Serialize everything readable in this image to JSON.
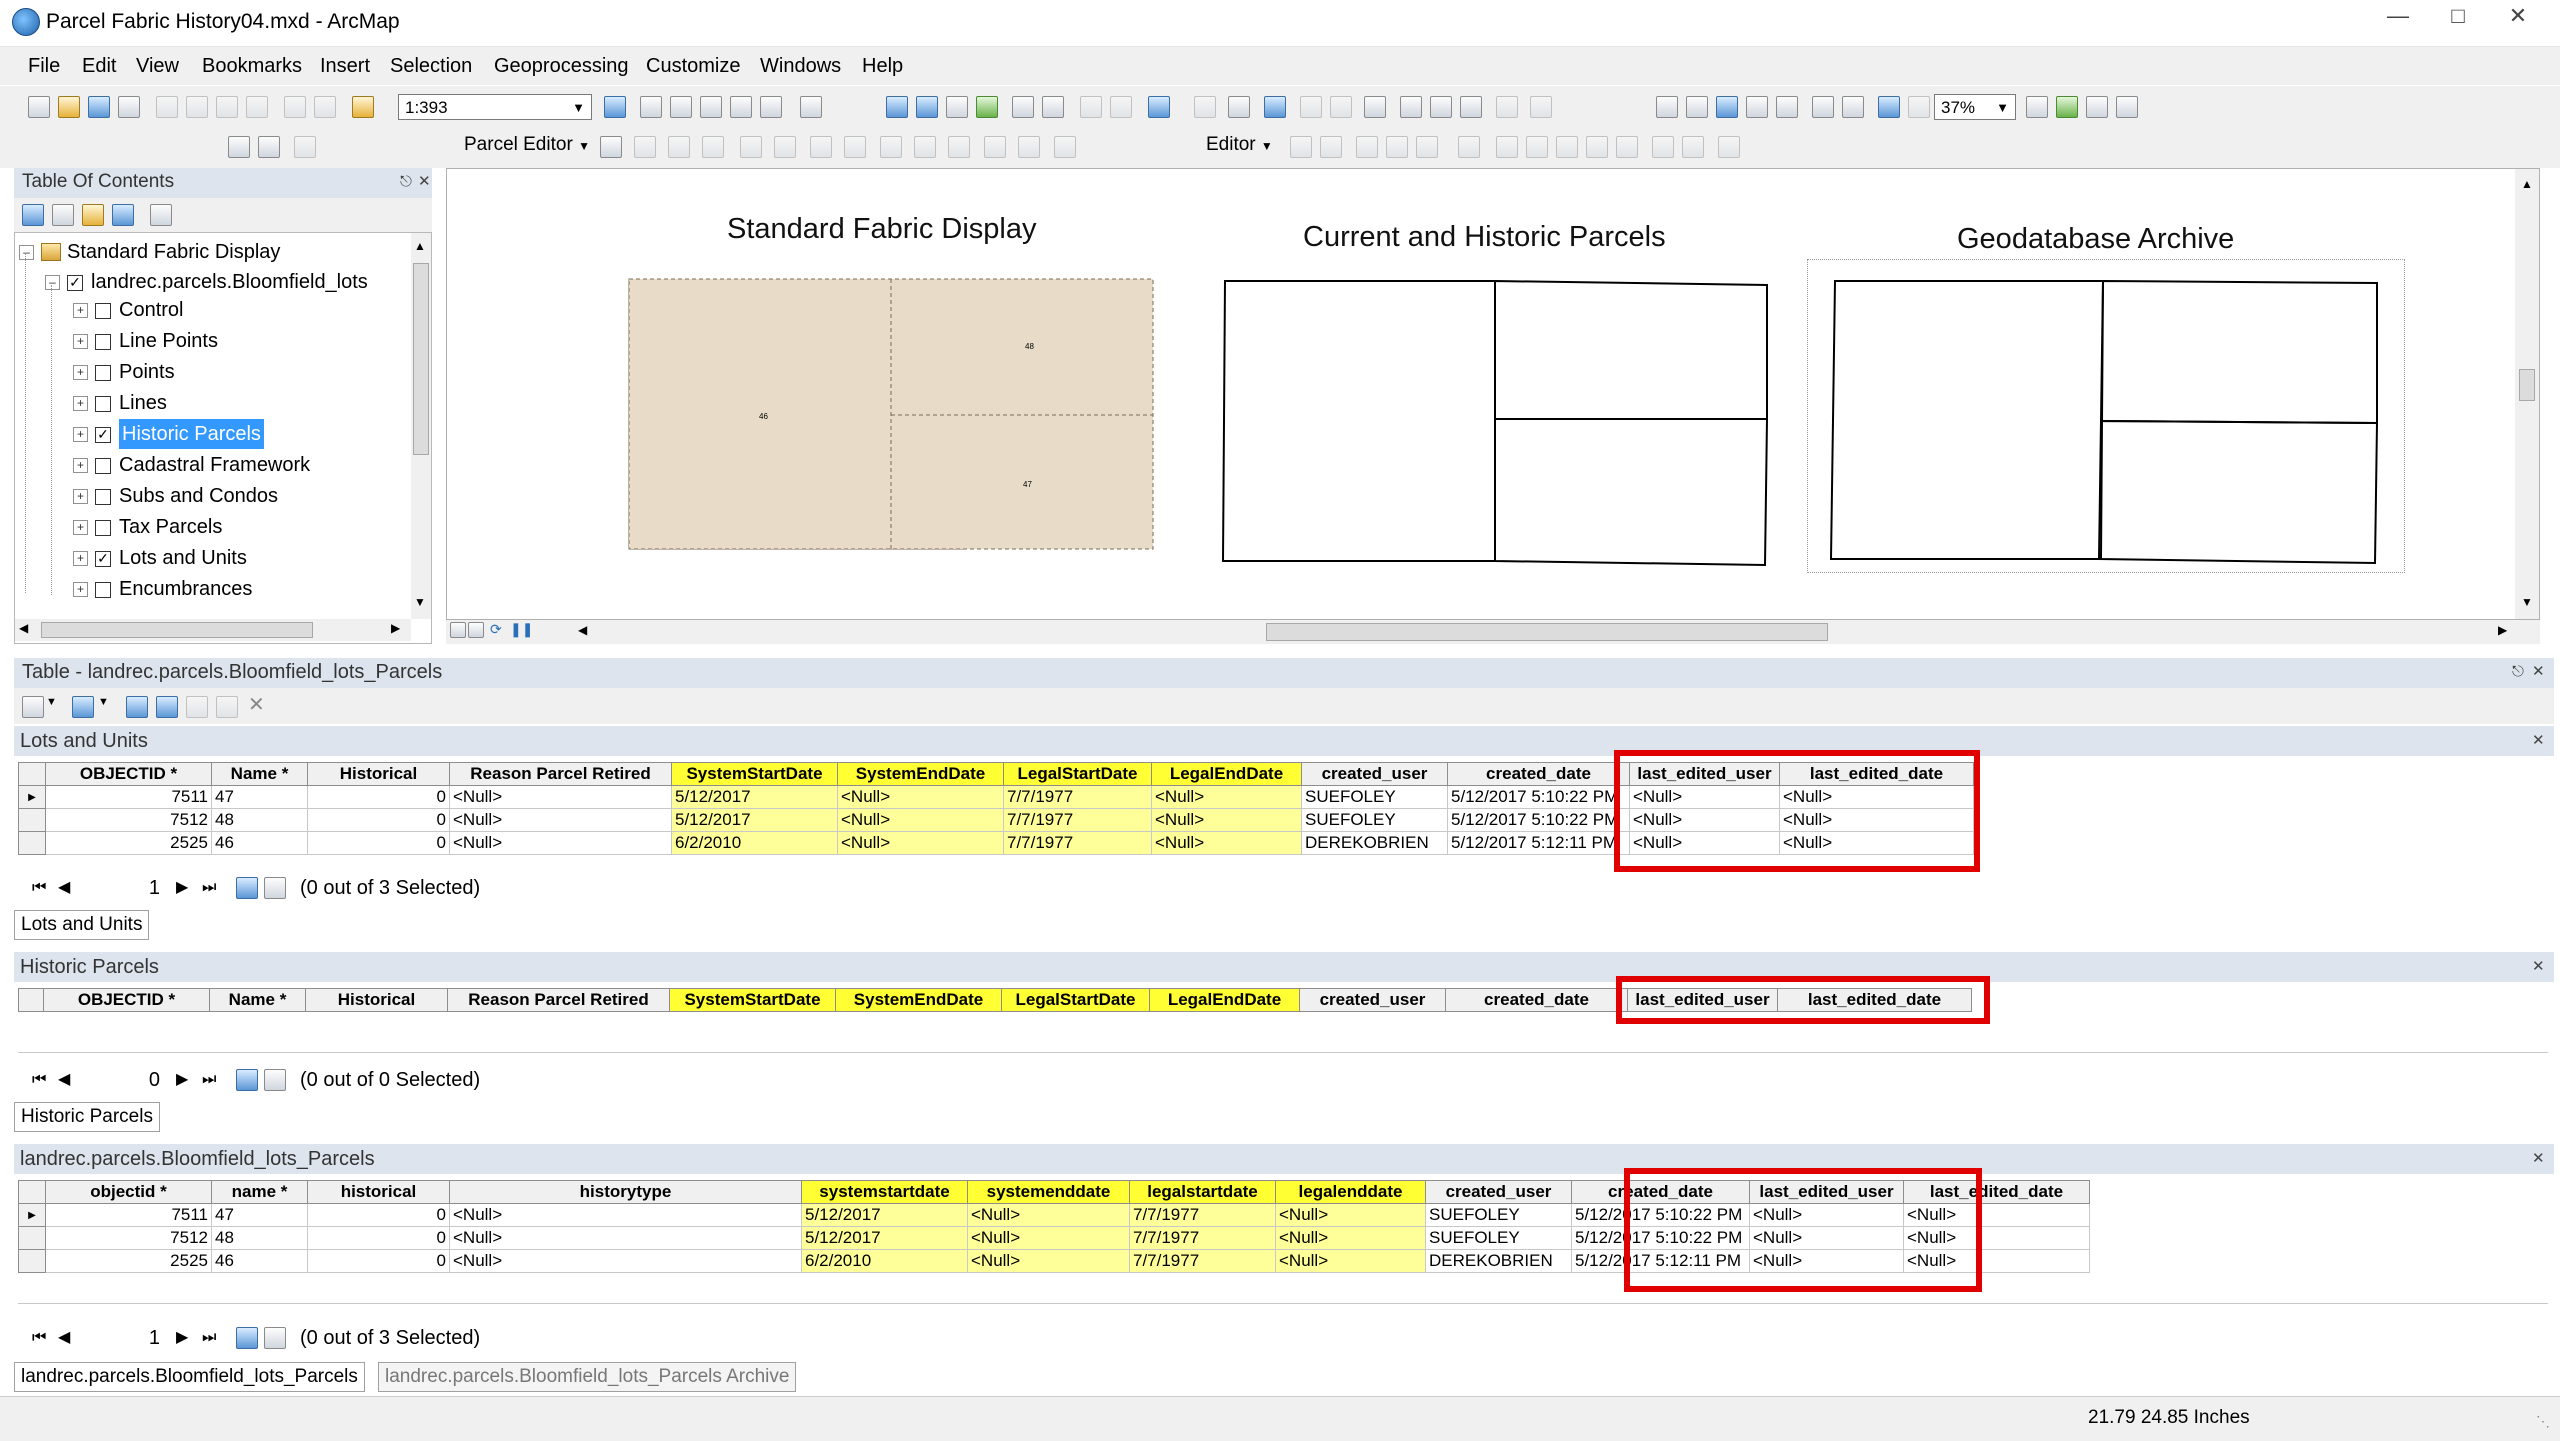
{
  "window": {
    "title": "Parcel Fabric History04.mxd - ArcMap"
  },
  "menu": [
    "File",
    "Edit",
    "View",
    "Bookmarks",
    "Insert",
    "Selection",
    "Geoprocessing",
    "Customize",
    "Windows",
    "Help"
  ],
  "toolbar": {
    "scale": "1:393",
    "zoom": "37%",
    "parcel_editor": "Parcel Editor",
    "editor": "Editor"
  },
  "toc": {
    "title": "Table Of Contents",
    "root": "Standard Fabric Display",
    "layer": "landrec.parcels.Bloomfield_lots",
    "items": [
      {
        "label": "Control",
        "checked": false
      },
      {
        "label": "Line Points",
        "checked": false
      },
      {
        "label": "Points",
        "checked": false
      },
      {
        "label": "Lines",
        "checked": false
      },
      {
        "label": "Historic Parcels",
        "checked": true
      },
      {
        "label": "Cadastral Framework",
        "checked": false
      },
      {
        "label": "Subs and Condos",
        "checked": false
      },
      {
        "label": "Tax Parcels",
        "checked": false
      },
      {
        "label": "Lots and Units",
        "checked": true
      },
      {
        "label": "Encumbrances",
        "checked": false
      }
    ]
  },
  "map": {
    "frames": [
      "Standard Fabric Display",
      "Current and Historic Parcels",
      "Geodatabase Archive"
    ],
    "parcel_labels": [
      "46",
      "48",
      "47"
    ]
  },
  "table_window": {
    "title": "Table - landrec.parcels.Bloomfield_lots_Parcels"
  },
  "tables": [
    {
      "title": "Lots and Units",
      "tab": "Lots and Units",
      "columns": [
        "OBJECTID *",
        "Name *",
        "Historical",
        "Reason Parcel Retired",
        "SystemStartDate",
        "SystemEndDate",
        "LegalStartDate",
        "LegalEndDate",
        "created_user",
        "created_date",
        "last_edited_user",
        "last_edited_date"
      ],
      "rows": [
        [
          "7511",
          "47",
          "0",
          "<Null>",
          "5/12/2017",
          "<Null>",
          "7/7/1977",
          "<Null>",
          "SUEFOLEY",
          "5/12/2017 5:10:22 PM",
          "<Null>",
          "<Null>"
        ],
        [
          "7512",
          "48",
          "0",
          "<Null>",
          "5/12/2017",
          "<Null>",
          "7/7/1977",
          "<Null>",
          "SUEFOLEY",
          "5/12/2017 5:10:22 PM",
          "<Null>",
          "<Null>"
        ],
        [
          "2525",
          "46",
          "0",
          "<Null>",
          "6/2/2010",
          "<Null>",
          "7/7/1977",
          "<Null>",
          "DEREKOBRIEN",
          "5/12/2017 5:12:11 PM",
          "<Null>",
          "<Null>"
        ]
      ],
      "record": "1",
      "selected": "(0 out of 3 Selected)"
    },
    {
      "title": "Historic Parcels",
      "tab": "Historic Parcels",
      "columns": [
        "OBJECTID *",
        "Name *",
        "Historical",
        "Reason Parcel Retired",
        "SystemStartDate",
        "SystemEndDate",
        "LegalStartDate",
        "LegalEndDate",
        "created_user",
        "created_date",
        "last_edited_user",
        "last_edited_date"
      ],
      "rows": [],
      "record": "0",
      "selected": "(0 out of 0 Selected)"
    },
    {
      "title": "landrec.parcels.Bloomfield_lots_Parcels",
      "tab": "landrec.parcels.Bloomfield_lots_Parcels",
      "tab2": "landrec.parcels.Bloomfield_lots_Parcels Archive",
      "columns": [
        "objectid *",
        "name *",
        "historical",
        "historytype",
        "systemstartdate",
        "systemenddate",
        "legalstartdate",
        "legalenddate",
        "created_user",
        "created_date",
        "last_edited_user",
        "last_edited_date"
      ],
      "rows": [
        [
          "7511",
          "47",
          "0",
          "<Null>",
          "5/12/2017",
          "<Null>",
          "7/7/1977",
          "<Null>",
          "SUEFOLEY",
          "5/12/2017 5:10:22 PM",
          "<Null>",
          "<Null>"
        ],
        [
          "7512",
          "48",
          "0",
          "<Null>",
          "5/12/2017",
          "<Null>",
          "7/7/1977",
          "<Null>",
          "SUEFOLEY",
          "5/12/2017 5:10:22 PM",
          "<Null>",
          "<Null>"
        ],
        [
          "2525",
          "46",
          "0",
          "<Null>",
          "6/2/2010",
          "<Null>",
          "7/7/1977",
          "<Null>",
          "DEREKOBRIEN",
          "5/12/2017 5:12:11 PM",
          "<Null>",
          "<Null>"
        ]
      ],
      "record": "1",
      "selected": "(0 out of 3 Selected)"
    }
  ],
  "status": {
    "coords": "21.79  24.85 Inches"
  },
  "colors": {
    "highlight_header": "#ffff33",
    "highlight_cell": "#ffff99",
    "callout": "#e00000",
    "parcel_fill": "#e8dcc8"
  }
}
